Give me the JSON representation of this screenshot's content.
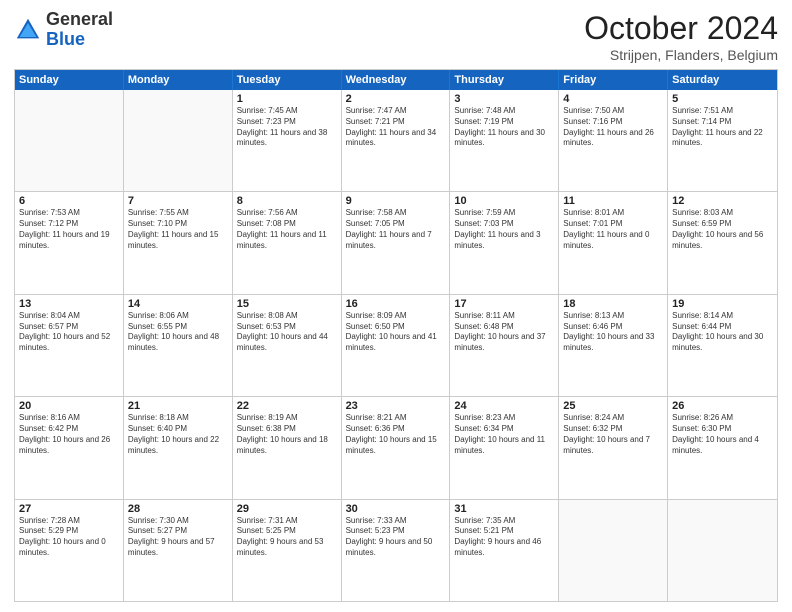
{
  "header": {
    "logo_general": "General",
    "logo_blue": "Blue",
    "month_title": "October 2024",
    "location": "Strijpen, Flanders, Belgium"
  },
  "weekdays": [
    "Sunday",
    "Monday",
    "Tuesday",
    "Wednesday",
    "Thursday",
    "Friday",
    "Saturday"
  ],
  "rows": [
    [
      {
        "day": "",
        "sunrise": "",
        "sunset": "",
        "daylight": "",
        "empty": true
      },
      {
        "day": "",
        "sunrise": "",
        "sunset": "",
        "daylight": "",
        "empty": true
      },
      {
        "day": "1",
        "sunrise": "Sunrise: 7:45 AM",
        "sunset": "Sunset: 7:23 PM",
        "daylight": "Daylight: 11 hours and 38 minutes."
      },
      {
        "day": "2",
        "sunrise": "Sunrise: 7:47 AM",
        "sunset": "Sunset: 7:21 PM",
        "daylight": "Daylight: 11 hours and 34 minutes."
      },
      {
        "day": "3",
        "sunrise": "Sunrise: 7:48 AM",
        "sunset": "Sunset: 7:19 PM",
        "daylight": "Daylight: 11 hours and 30 minutes."
      },
      {
        "day": "4",
        "sunrise": "Sunrise: 7:50 AM",
        "sunset": "Sunset: 7:16 PM",
        "daylight": "Daylight: 11 hours and 26 minutes."
      },
      {
        "day": "5",
        "sunrise": "Sunrise: 7:51 AM",
        "sunset": "Sunset: 7:14 PM",
        "daylight": "Daylight: 11 hours and 22 minutes."
      }
    ],
    [
      {
        "day": "6",
        "sunrise": "Sunrise: 7:53 AM",
        "sunset": "Sunset: 7:12 PM",
        "daylight": "Daylight: 11 hours and 19 minutes."
      },
      {
        "day": "7",
        "sunrise": "Sunrise: 7:55 AM",
        "sunset": "Sunset: 7:10 PM",
        "daylight": "Daylight: 11 hours and 15 minutes."
      },
      {
        "day": "8",
        "sunrise": "Sunrise: 7:56 AM",
        "sunset": "Sunset: 7:08 PM",
        "daylight": "Daylight: 11 hours and 11 minutes."
      },
      {
        "day": "9",
        "sunrise": "Sunrise: 7:58 AM",
        "sunset": "Sunset: 7:05 PM",
        "daylight": "Daylight: 11 hours and 7 minutes."
      },
      {
        "day": "10",
        "sunrise": "Sunrise: 7:59 AM",
        "sunset": "Sunset: 7:03 PM",
        "daylight": "Daylight: 11 hours and 3 minutes."
      },
      {
        "day": "11",
        "sunrise": "Sunrise: 8:01 AM",
        "sunset": "Sunset: 7:01 PM",
        "daylight": "Daylight: 11 hours and 0 minutes."
      },
      {
        "day": "12",
        "sunrise": "Sunrise: 8:03 AM",
        "sunset": "Sunset: 6:59 PM",
        "daylight": "Daylight: 10 hours and 56 minutes."
      }
    ],
    [
      {
        "day": "13",
        "sunrise": "Sunrise: 8:04 AM",
        "sunset": "Sunset: 6:57 PM",
        "daylight": "Daylight: 10 hours and 52 minutes."
      },
      {
        "day": "14",
        "sunrise": "Sunrise: 8:06 AM",
        "sunset": "Sunset: 6:55 PM",
        "daylight": "Daylight: 10 hours and 48 minutes."
      },
      {
        "day": "15",
        "sunrise": "Sunrise: 8:08 AM",
        "sunset": "Sunset: 6:53 PM",
        "daylight": "Daylight: 10 hours and 44 minutes."
      },
      {
        "day": "16",
        "sunrise": "Sunrise: 8:09 AM",
        "sunset": "Sunset: 6:50 PM",
        "daylight": "Daylight: 10 hours and 41 minutes."
      },
      {
        "day": "17",
        "sunrise": "Sunrise: 8:11 AM",
        "sunset": "Sunset: 6:48 PM",
        "daylight": "Daylight: 10 hours and 37 minutes."
      },
      {
        "day": "18",
        "sunrise": "Sunrise: 8:13 AM",
        "sunset": "Sunset: 6:46 PM",
        "daylight": "Daylight: 10 hours and 33 minutes."
      },
      {
        "day": "19",
        "sunrise": "Sunrise: 8:14 AM",
        "sunset": "Sunset: 6:44 PM",
        "daylight": "Daylight: 10 hours and 30 minutes."
      }
    ],
    [
      {
        "day": "20",
        "sunrise": "Sunrise: 8:16 AM",
        "sunset": "Sunset: 6:42 PM",
        "daylight": "Daylight: 10 hours and 26 minutes."
      },
      {
        "day": "21",
        "sunrise": "Sunrise: 8:18 AM",
        "sunset": "Sunset: 6:40 PM",
        "daylight": "Daylight: 10 hours and 22 minutes."
      },
      {
        "day": "22",
        "sunrise": "Sunrise: 8:19 AM",
        "sunset": "Sunset: 6:38 PM",
        "daylight": "Daylight: 10 hours and 18 minutes."
      },
      {
        "day": "23",
        "sunrise": "Sunrise: 8:21 AM",
        "sunset": "Sunset: 6:36 PM",
        "daylight": "Daylight: 10 hours and 15 minutes."
      },
      {
        "day": "24",
        "sunrise": "Sunrise: 8:23 AM",
        "sunset": "Sunset: 6:34 PM",
        "daylight": "Daylight: 10 hours and 11 minutes."
      },
      {
        "day": "25",
        "sunrise": "Sunrise: 8:24 AM",
        "sunset": "Sunset: 6:32 PM",
        "daylight": "Daylight: 10 hours and 7 minutes."
      },
      {
        "day": "26",
        "sunrise": "Sunrise: 8:26 AM",
        "sunset": "Sunset: 6:30 PM",
        "daylight": "Daylight: 10 hours and 4 minutes."
      }
    ],
    [
      {
        "day": "27",
        "sunrise": "Sunrise: 7:28 AM",
        "sunset": "Sunset: 5:29 PM",
        "daylight": "Daylight: 10 hours and 0 minutes."
      },
      {
        "day": "28",
        "sunrise": "Sunrise: 7:30 AM",
        "sunset": "Sunset: 5:27 PM",
        "daylight": "Daylight: 9 hours and 57 minutes."
      },
      {
        "day": "29",
        "sunrise": "Sunrise: 7:31 AM",
        "sunset": "Sunset: 5:25 PM",
        "daylight": "Daylight: 9 hours and 53 minutes."
      },
      {
        "day": "30",
        "sunrise": "Sunrise: 7:33 AM",
        "sunset": "Sunset: 5:23 PM",
        "daylight": "Daylight: 9 hours and 50 minutes."
      },
      {
        "day": "31",
        "sunrise": "Sunrise: 7:35 AM",
        "sunset": "Sunset: 5:21 PM",
        "daylight": "Daylight: 9 hours and 46 minutes."
      },
      {
        "day": "",
        "sunrise": "",
        "sunset": "",
        "daylight": "",
        "empty": true
      },
      {
        "day": "",
        "sunrise": "",
        "sunset": "",
        "daylight": "",
        "empty": true
      }
    ]
  ]
}
